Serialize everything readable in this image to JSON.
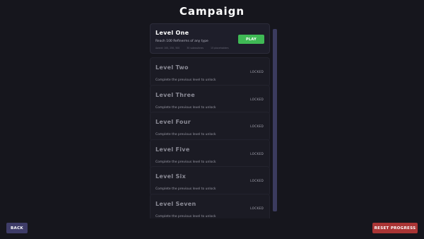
{
  "header": {
    "title": "Campaign"
  },
  "levels": [
    {
      "name": "Level One",
      "description": "Reach 100 Refinerms of any type",
      "meta": [
        "Award: 100, 250, 500",
        "30 subroutines",
        "15 placeholders"
      ],
      "action_label": "PLAY",
      "locked": false
    },
    {
      "name": "Level Two",
      "description": "Complete the previous level to unlock",
      "status_label": "LOCKED",
      "locked": true
    },
    {
      "name": "Level Three",
      "description": "Complete the previous level to unlock",
      "status_label": "LOCKED",
      "locked": true
    },
    {
      "name": "Level Four",
      "description": "Complete the previous level to unlock",
      "status_label": "LOCKED",
      "locked": true
    },
    {
      "name": "Level Five",
      "description": "Complete the previous level to unlock",
      "status_label": "LOCKED",
      "locked": true
    },
    {
      "name": "Level Six",
      "description": "Complete the previous level to unlock",
      "status_label": "LOCKED",
      "locked": true
    },
    {
      "name": "Level Seven",
      "description": "Complete the previous level to unlock",
      "status_label": "LOCKED",
      "locked": true
    }
  ],
  "footer": {
    "back_label": "BACK",
    "reset_label": "RESET PROGRESS"
  },
  "colors": {
    "background": "#16161d",
    "play": "#3fb955",
    "back": "#3e3c68",
    "reset": "#aa3535"
  }
}
